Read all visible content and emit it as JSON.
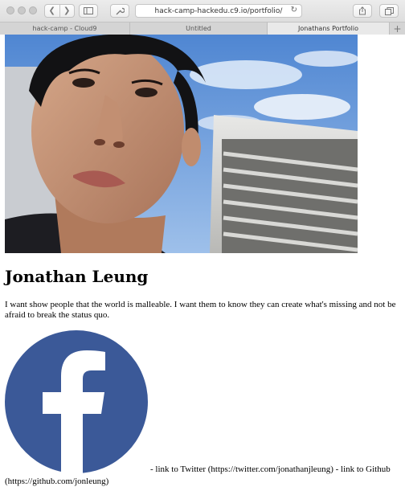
{
  "browser": {
    "url": "hack-camp-hackedu.c9.io/portfolio/",
    "tabs": [
      {
        "label": "hack-camp - Cloud9",
        "active": false
      },
      {
        "label": "Untitled",
        "active": false
      },
      {
        "label": "Jonathans Portfolio",
        "active": true
      }
    ],
    "new_tab_label": "+",
    "icons": {
      "back": "chevron-left-icon",
      "forward": "chevron-right-icon",
      "sidebar": "sidebar-icon",
      "tools": "wrench-icon",
      "reload": "reload-icon",
      "share": "share-icon",
      "tabs_overview": "tabs-overview-icon"
    }
  },
  "profile": {
    "name": "Jonathan Leung",
    "bio": "I want show people that the world is malleable. I want them to know they can create what's missing and not be afraid to break the status quo.",
    "links_line1": "- link to Twitter (https://twitter.com/jonathanjleung) - link to Github",
    "links_line2": "(https://github.com/jonleung)",
    "facebook_icon": "facebook-logo-icon"
  },
  "colors": {
    "facebook_blue": "#3b5998",
    "sky_blue": "#5b8fd6"
  }
}
